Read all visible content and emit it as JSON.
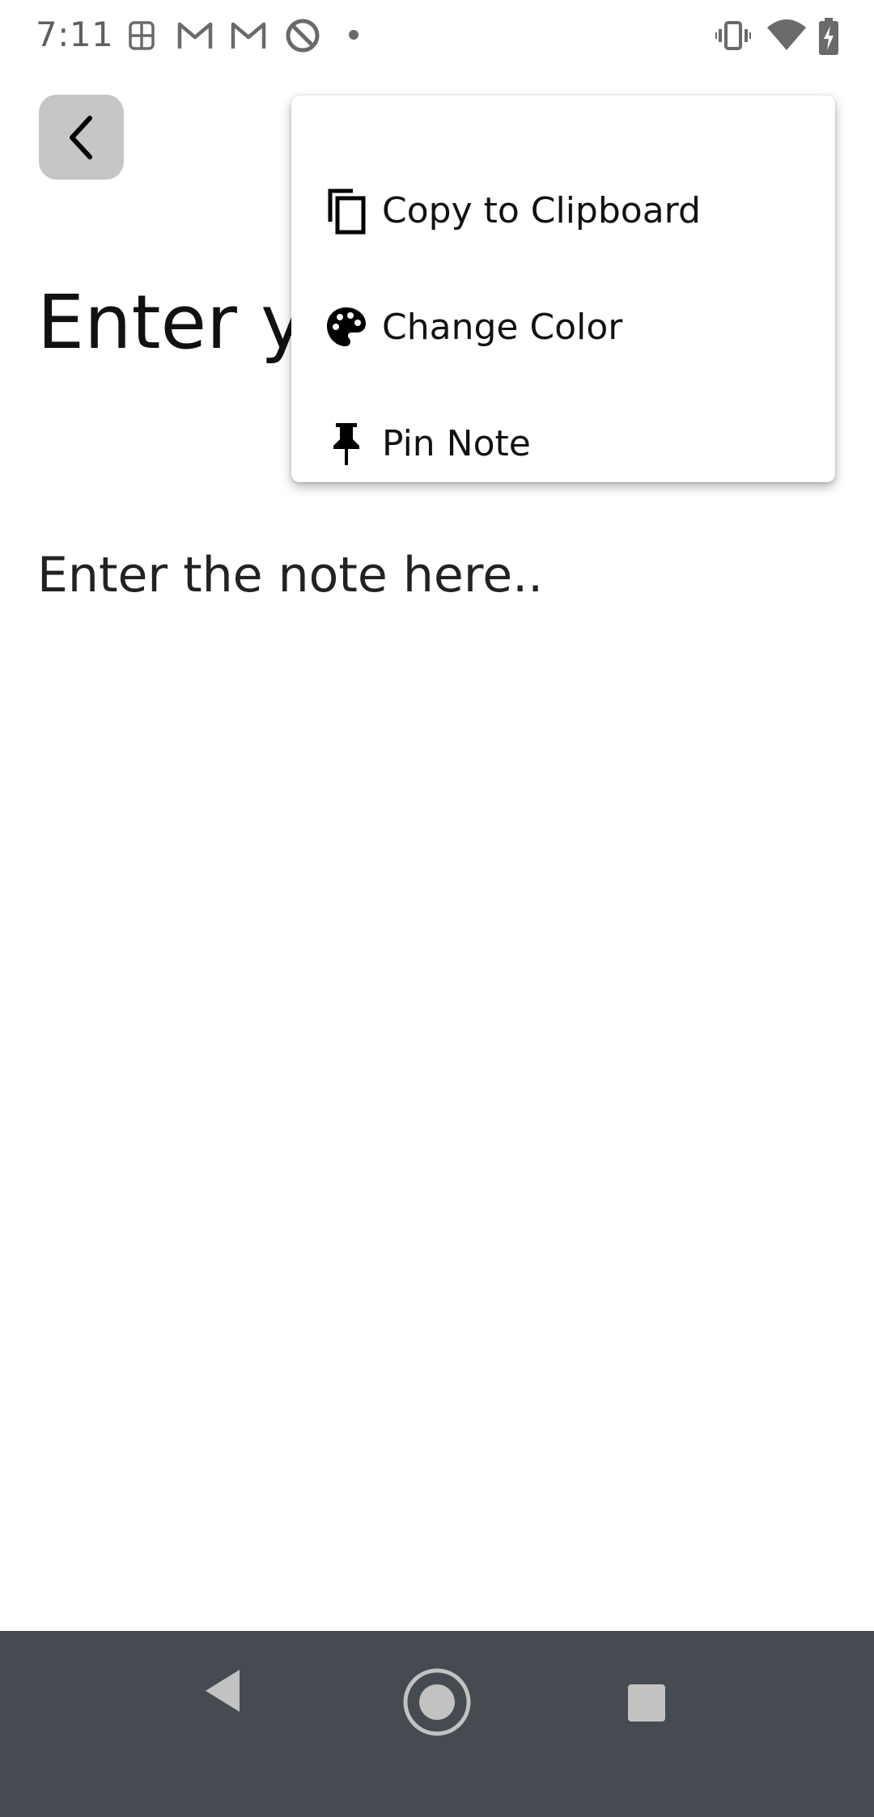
{
  "status_bar": {
    "time": "7:11",
    "left_icons": [
      "grid-app-icon",
      "gmail-icon",
      "gmail-icon",
      "at-sign-icon",
      "dot-icon"
    ],
    "right_icons": [
      "vibrate-icon",
      "wifi-icon",
      "battery-charging-icon"
    ]
  },
  "editor": {
    "back_icon": "chevron-left-icon",
    "title_placeholder": "Enter yo",
    "note_placeholder": "Enter the note here.."
  },
  "menu": {
    "items": [
      {
        "label": "Copy to Clipboard",
        "icon": "copy-icon"
      },
      {
        "label": "Change Color",
        "icon": "palette-icon"
      },
      {
        "label": "Pin Note",
        "icon": "pin-icon"
      }
    ]
  },
  "nav_bar": {
    "background": "#454b50",
    "icons": [
      "nav-back-icon",
      "nav-home-icon",
      "nav-recents-icon"
    ]
  }
}
